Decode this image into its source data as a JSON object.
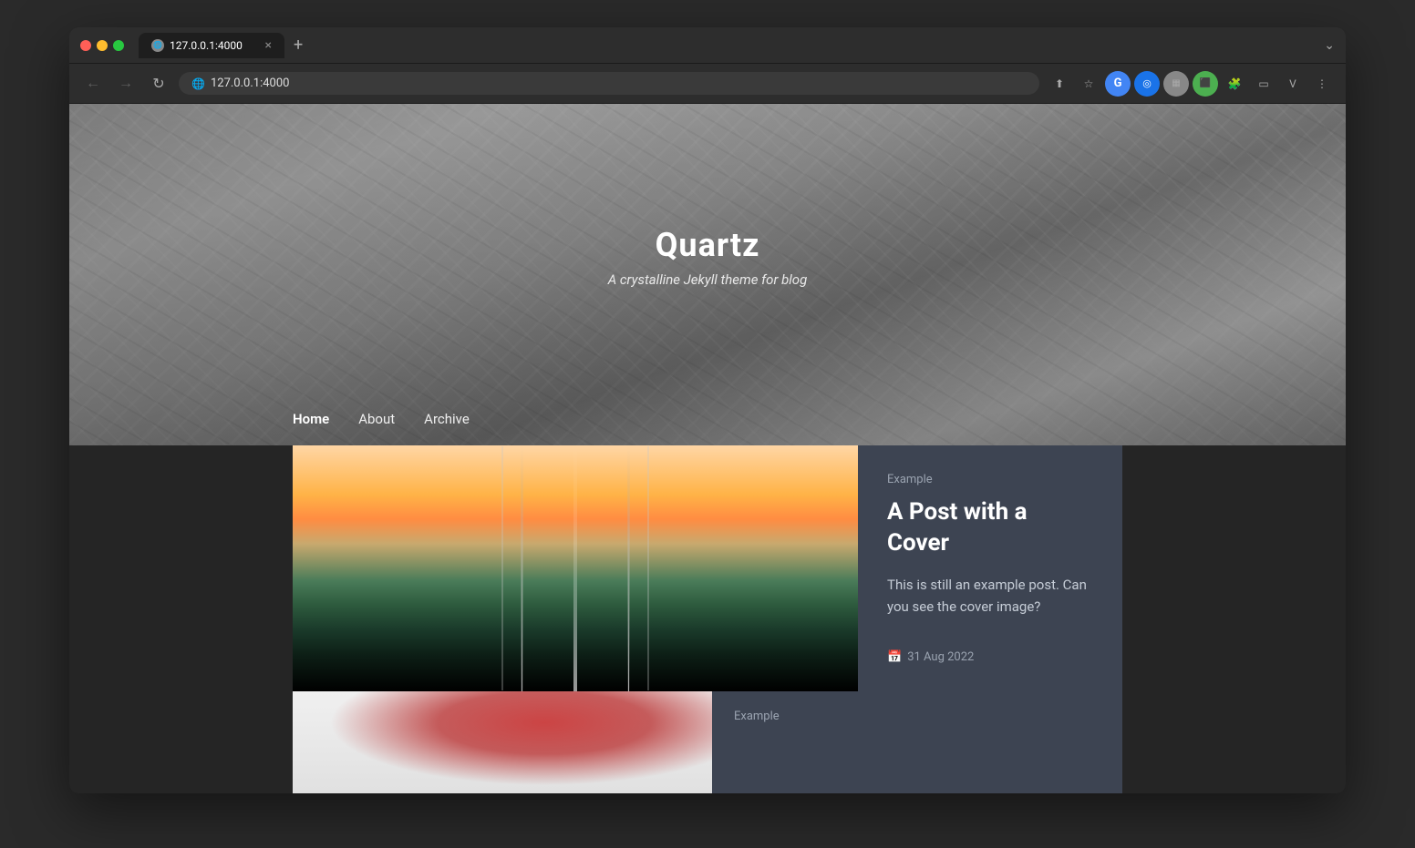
{
  "browser": {
    "url": "127.0.0.1:4000",
    "url_display": "127.0.0.1:4000",
    "tab_title": "127.0.0.1:4000",
    "tab_favicon": "🌐",
    "new_tab_label": "+",
    "back_btn": "←",
    "forward_btn": "→",
    "reload_btn": "↺"
  },
  "hero": {
    "title": "Quartz",
    "subtitle": "A crystalline Jekyll theme for blog"
  },
  "nav": {
    "items": [
      {
        "label": "Home",
        "active": true
      },
      {
        "label": "About",
        "active": false
      },
      {
        "label": "Archive",
        "active": false
      }
    ]
  },
  "posts": [
    {
      "category": "Example",
      "title": "A Post with a Cover",
      "excerpt": "This is still an example post. Can you see the cover image?",
      "date": "31 Aug 2022"
    },
    {
      "category": "Example",
      "title": "",
      "excerpt": "",
      "date": ""
    }
  ]
}
